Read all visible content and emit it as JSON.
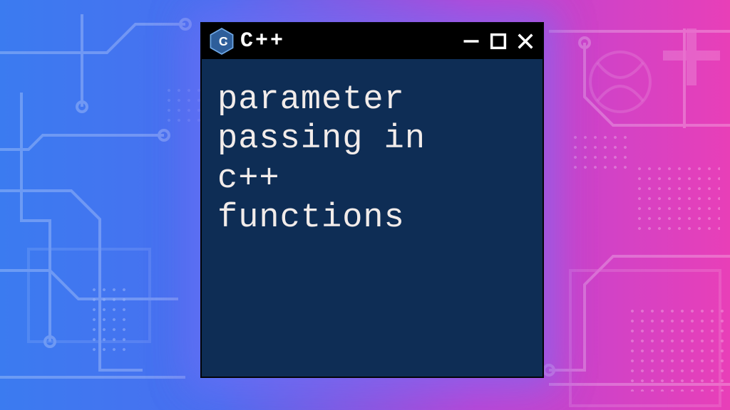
{
  "window": {
    "title": "C++",
    "icon_label": "C++"
  },
  "content": {
    "lines": [
      "parameter",
      "passing in",
      "c++",
      "functions"
    ]
  },
  "colors": {
    "window_bg": "#0e2d55",
    "titlebar_bg": "#000000",
    "text": "#f2ecea",
    "icon_fill": "#2e5e9a",
    "icon_outline": "#6fa8e6"
  }
}
